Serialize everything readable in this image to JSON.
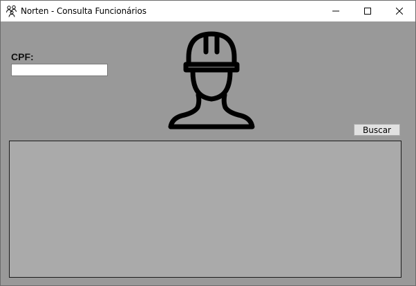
{
  "window": {
    "title": "Norten - Consulta Funcionários",
    "controls": [
      "minimize-icon",
      "maximize-icon",
      "close-icon"
    ]
  },
  "form": {
    "cpf_label": "CPF:",
    "cpf_value": "",
    "search_label": "Buscar"
  },
  "colors": {
    "background": "#999999",
    "results_background": "#aaaaaa",
    "titlebar": "#ffffff"
  },
  "icons": {
    "app": "people-icon",
    "illustration": "construction-worker-icon"
  }
}
